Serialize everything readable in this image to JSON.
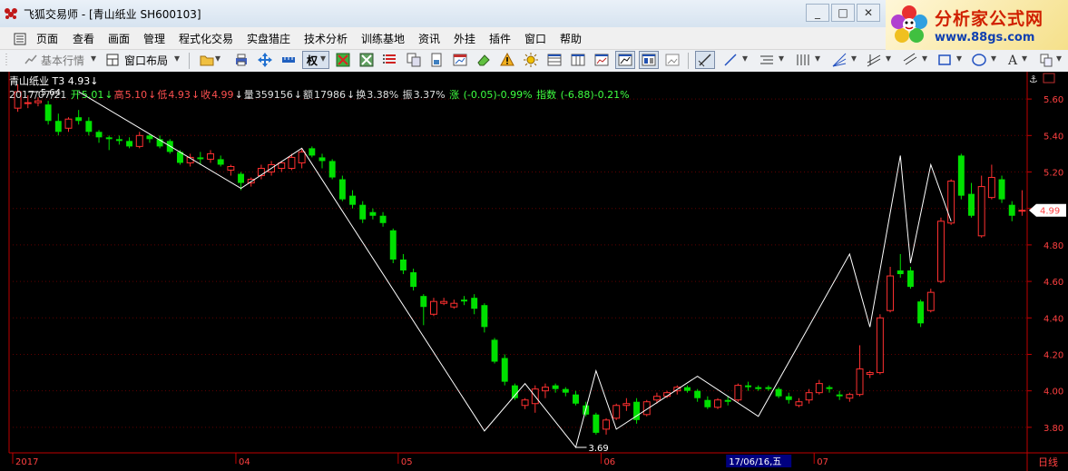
{
  "window": {
    "title": "飞狐交易师 - [青山纸业 SH600103]",
    "btn_min": "_",
    "btn_max": "□",
    "btn_close": "✕"
  },
  "brand": {
    "name": "分析家公式网",
    "url": "www.88gs.com"
  },
  "menu": [
    "页面",
    "查看",
    "画面",
    "管理",
    "程式化交易",
    "实盘猎庄",
    "技术分析",
    "训练基地",
    "资讯",
    "外挂",
    "插件",
    "窗口",
    "帮助"
  ],
  "toolbar": {
    "basic_quote": "基本行情",
    "window_layout": "窗口布局",
    "rights": "权"
  },
  "stock": {
    "name": "青山纸业",
    "cycle_label": "T3",
    "price": "4.93",
    "arrow": "↓",
    "date": "2017/07/21",
    "open_label": "开",
    "open": "5.01",
    "high_label": "高",
    "high": "5.10",
    "low_label": "低",
    "low": "4.93",
    "close_label": "收",
    "close": "4.99",
    "vol_label": "量",
    "vol": "359156",
    "amt_label": "额",
    "amt": "17986",
    "turn_label": "换",
    "turn": "3.38%",
    "amp_label": "振",
    "amp": "3.37%",
    "chg_label": "涨",
    "chg": "(-0.05)-0.99%",
    "idx_label": "指数",
    "idx": "(-6.88)-0.21%"
  },
  "colors": {
    "up": "#ff3030",
    "down": "#00e000",
    "zigzag": "#ffffff",
    "axis": "#c00000"
  },
  "chart_data": {
    "type": "candlestick",
    "y_ticks": [
      "5.60",
      "5.40",
      "5.20",
      "5.00",
      "4.80",
      "4.60",
      "4.40",
      "4.20",
      "4.00",
      "3.80"
    ],
    "ylim": [
      3.66,
      5.72
    ],
    "current_price_tag": "4.99",
    "x_labels": [
      {
        "label": "2017",
        "index": 0
      },
      {
        "label": "04",
        "index": 22
      },
      {
        "label": "05",
        "index": 38
      },
      {
        "label": "06",
        "index": 58
      },
      {
        "label": "07",
        "index": 79
      }
    ],
    "crosshair_date": "17/06/16,五",
    "crosshair_index": 70,
    "cycle": "日线",
    "annotations": [
      {
        "text": "5.64",
        "index": 1,
        "value": 5.64
      },
      {
        "text": "3.69",
        "index": 55,
        "value": 3.69
      }
    ],
    "zigzag": [
      {
        "index": 6,
        "value": 5.64
      },
      {
        "index": 22,
        "value": 5.11
      },
      {
        "index": 28,
        "value": 5.33
      },
      {
        "index": 46,
        "value": 3.78
      },
      {
        "index": 50,
        "value": 4.04
      },
      {
        "index": 55,
        "value": 3.69
      },
      {
        "index": 57,
        "value": 4.11
      },
      {
        "index": 59,
        "value": 3.79
      },
      {
        "index": 67,
        "value": 4.08
      },
      {
        "index": 73,
        "value": 3.86
      },
      {
        "index": 82,
        "value": 4.75
      },
      {
        "index": 84,
        "value": 4.35
      },
      {
        "index": 87,
        "value": 5.29
      },
      {
        "index": 88,
        "value": 4.7
      },
      {
        "index": 90,
        "value": 5.24
      },
      {
        "index": 92,
        "value": 4.93
      }
    ],
    "candles": [
      {
        "o": 5.55,
        "h": 5.68,
        "l": 5.53,
        "c": 5.64
      },
      {
        "o": 5.58,
        "h": 5.62,
        "l": 5.55,
        "c": 5.58
      },
      {
        "o": 5.58,
        "h": 5.61,
        "l": 5.56,
        "c": 5.59
      },
      {
        "o": 5.57,
        "h": 5.59,
        "l": 5.46,
        "c": 5.48
      },
      {
        "o": 5.48,
        "h": 5.52,
        "l": 5.4,
        "c": 5.42
      },
      {
        "o": 5.44,
        "h": 5.5,
        "l": 5.42,
        "c": 5.49
      },
      {
        "o": 5.5,
        "h": 5.54,
        "l": 5.46,
        "c": 5.48
      },
      {
        "o": 5.48,
        "h": 5.5,
        "l": 5.4,
        "c": 5.42
      },
      {
        "o": 5.42,
        "h": 5.43,
        "l": 5.36,
        "c": 5.39
      },
      {
        "o": 5.39,
        "h": 5.4,
        "l": 5.32,
        "c": 5.38
      },
      {
        "o": 5.38,
        "h": 5.4,
        "l": 5.35,
        "c": 5.37
      },
      {
        "o": 5.37,
        "h": 5.39,
        "l": 5.33,
        "c": 5.34
      },
      {
        "o": 5.34,
        "h": 5.42,
        "l": 5.33,
        "c": 5.4
      },
      {
        "o": 5.4,
        "h": 5.41,
        "l": 5.36,
        "c": 5.38
      },
      {
        "o": 5.38,
        "h": 5.4,
        "l": 5.33,
        "c": 5.34
      },
      {
        "o": 5.37,
        "h": 5.38,
        "l": 5.3,
        "c": 5.31
      },
      {
        "o": 5.31,
        "h": 5.32,
        "l": 5.24,
        "c": 5.25
      },
      {
        "o": 5.25,
        "h": 5.3,
        "l": 5.23,
        "c": 5.28
      },
      {
        "o": 5.28,
        "h": 5.31,
        "l": 5.24,
        "c": 5.27
      },
      {
        "o": 5.27,
        "h": 5.32,
        "l": 5.25,
        "c": 5.3
      },
      {
        "o": 5.27,
        "h": 5.29,
        "l": 5.23,
        "c": 5.24
      },
      {
        "o": 5.21,
        "h": 5.24,
        "l": 5.18,
        "c": 5.23
      },
      {
        "o": 5.19,
        "h": 5.2,
        "l": 5.1,
        "c": 5.14
      },
      {
        "o": 5.14,
        "h": 5.17,
        "l": 5.12,
        "c": 5.16
      },
      {
        "o": 5.18,
        "h": 5.24,
        "l": 5.16,
        "c": 5.22
      },
      {
        "o": 5.2,
        "h": 5.26,
        "l": 5.18,
        "c": 5.24
      },
      {
        "o": 5.22,
        "h": 5.26,
        "l": 5.2,
        "c": 5.25
      },
      {
        "o": 5.22,
        "h": 5.3,
        "l": 5.21,
        "c": 5.28
      },
      {
        "o": 5.25,
        "h": 5.33,
        "l": 5.22,
        "c": 5.31
      },
      {
        "o": 5.33,
        "h": 5.34,
        "l": 5.28,
        "c": 5.29
      },
      {
        "o": 5.28,
        "h": 5.3,
        "l": 5.22,
        "c": 5.26
      },
      {
        "o": 5.26,
        "h": 5.27,
        "l": 5.16,
        "c": 5.17
      },
      {
        "o": 5.16,
        "h": 5.18,
        "l": 5.04,
        "c": 5.05
      },
      {
        "o": 5.07,
        "h": 5.1,
        "l": 5.0,
        "c": 5.02
      },
      {
        "o": 5.02,
        "h": 5.04,
        "l": 4.92,
        "c": 4.94
      },
      {
        "o": 4.98,
        "h": 5.0,
        "l": 4.94,
        "c": 4.96
      },
      {
        "o": 4.96,
        "h": 4.98,
        "l": 4.9,
        "c": 4.92
      },
      {
        "o": 4.88,
        "h": 4.89,
        "l": 4.7,
        "c": 4.72
      },
      {
        "o": 4.72,
        "h": 4.75,
        "l": 4.64,
        "c": 4.66
      },
      {
        "o": 4.65,
        "h": 4.67,
        "l": 4.55,
        "c": 4.57
      },
      {
        "o": 4.52,
        "h": 4.53,
        "l": 4.36,
        "c": 4.46
      },
      {
        "o": 4.42,
        "h": 4.51,
        "l": 4.41,
        "c": 4.49
      },
      {
        "o": 4.48,
        "h": 4.51,
        "l": 4.47,
        "c": 4.49
      },
      {
        "o": 4.46,
        "h": 4.5,
        "l": 4.45,
        "c": 4.48
      },
      {
        "o": 4.5,
        "h": 4.52,
        "l": 4.47,
        "c": 4.49
      },
      {
        "o": 4.51,
        "h": 4.53,
        "l": 4.42,
        "c": 4.45
      },
      {
        "o": 4.47,
        "h": 4.48,
        "l": 4.32,
        "c": 4.35
      },
      {
        "o": 4.28,
        "h": 4.29,
        "l": 4.15,
        "c": 4.16
      },
      {
        "o": 4.18,
        "h": 4.2,
        "l": 4.03,
        "c": 4.05
      },
      {
        "o": 4.03,
        "h": 4.04,
        "l": 3.95,
        "c": 3.96
      },
      {
        "o": 3.92,
        "h": 3.96,
        "l": 3.9,
        "c": 3.95
      },
      {
        "o": 3.93,
        "h": 4.03,
        "l": 3.88,
        "c": 4.01
      },
      {
        "o": 4.0,
        "h": 4.04,
        "l": 3.96,
        "c": 4.02
      },
      {
        "o": 4.03,
        "h": 4.04,
        "l": 3.99,
        "c": 4.01
      },
      {
        "o": 4.01,
        "h": 4.02,
        "l": 3.97,
        "c": 3.99
      },
      {
        "o": 3.98,
        "h": 4.0,
        "l": 3.92,
        "c": 3.93
      },
      {
        "o": 3.92,
        "h": 3.94,
        "l": 3.86,
        "c": 3.87
      },
      {
        "o": 3.87,
        "h": 3.88,
        "l": 3.76,
        "c": 3.77
      },
      {
        "o": 3.79,
        "h": 3.85,
        "l": 3.76,
        "c": 3.84
      },
      {
        "o": 3.85,
        "h": 3.93,
        "l": 3.84,
        "c": 3.92
      },
      {
        "o": 3.92,
        "h": 3.96,
        "l": 3.89,
        "c": 3.93
      },
      {
        "o": 3.94,
        "h": 3.96,
        "l": 3.82,
        "c": 3.84
      },
      {
        "o": 3.87,
        "h": 3.95,
        "l": 3.86,
        "c": 3.94
      },
      {
        "o": 3.95,
        "h": 3.99,
        "l": 3.93,
        "c": 3.97
      },
      {
        "o": 3.97,
        "h": 4.0,
        "l": 3.96,
        "c": 3.99
      },
      {
        "o": 4.0,
        "h": 4.03,
        "l": 3.98,
        "c": 4.02
      },
      {
        "o": 4.02,
        "h": 4.03,
        "l": 3.99,
        "c": 4.0
      },
      {
        "o": 4.0,
        "h": 4.01,
        "l": 3.94,
        "c": 3.96
      },
      {
        "o": 3.95,
        "h": 3.97,
        "l": 3.9,
        "c": 3.91
      },
      {
        "o": 3.91,
        "h": 3.96,
        "l": 3.9,
        "c": 3.95
      },
      {
        "o": 3.95,
        "h": 3.97,
        "l": 3.92,
        "c": 3.94
      },
      {
        "o": 3.95,
        "h": 4.04,
        "l": 3.94,
        "c": 4.03
      },
      {
        "o": 4.03,
        "h": 4.05,
        "l": 4.0,
        "c": 4.02
      },
      {
        "o": 4.02,
        "h": 4.03,
        "l": 4.0,
        "c": 4.01
      },
      {
        "o": 4.02,
        "h": 4.03,
        "l": 4.0,
        "c": 4.01
      },
      {
        "o": 4.01,
        "h": 4.02,
        "l": 3.96,
        "c": 3.97
      },
      {
        "o": 3.97,
        "h": 3.99,
        "l": 3.93,
        "c": 3.95
      },
      {
        "o": 3.92,
        "h": 3.96,
        "l": 3.91,
        "c": 3.94
      },
      {
        "o": 3.95,
        "h": 4.01,
        "l": 3.93,
        "c": 3.99
      },
      {
        "o": 3.99,
        "h": 4.06,
        "l": 3.98,
        "c": 4.04
      },
      {
        "o": 4.02,
        "h": 4.03,
        "l": 3.99,
        "c": 4.01
      },
      {
        "o": 3.98,
        "h": 4.0,
        "l": 3.95,
        "c": 3.97
      },
      {
        "o": 3.96,
        "h": 3.99,
        "l": 3.94,
        "c": 3.98
      },
      {
        "o": 3.98,
        "h": 4.25,
        "l": 3.97,
        "c": 4.12
      },
      {
        "o": 4.09,
        "h": 4.11,
        "l": 4.07,
        "c": 4.1
      },
      {
        "o": 4.1,
        "h": 4.42,
        "l": 4.09,
        "c": 4.4
      },
      {
        "o": 4.44,
        "h": 4.68,
        "l": 4.43,
        "c": 4.63
      },
      {
        "o": 4.66,
        "h": 4.75,
        "l": 4.62,
        "c": 4.64
      },
      {
        "o": 4.66,
        "h": 4.68,
        "l": 4.56,
        "c": 4.57
      },
      {
        "o": 4.49,
        "h": 4.5,
        "l": 4.35,
        "c": 4.37
      },
      {
        "o": 4.44,
        "h": 4.56,
        "l": 4.43,
        "c": 4.54
      },
      {
        "o": 4.6,
        "h": 4.95,
        "l": 4.59,
        "c": 4.93
      },
      {
        "o": 4.92,
        "h": 5.16,
        "l": 4.91,
        "c": 5.15
      },
      {
        "o": 5.29,
        "h": 5.3,
        "l": 5.05,
        "c": 5.07
      },
      {
        "o": 5.08,
        "h": 5.14,
        "l": 4.95,
        "c": 4.96
      },
      {
        "o": 4.85,
        "h": 5.18,
        "l": 4.84,
        "c": 5.12
      },
      {
        "o": 5.06,
        "h": 5.24,
        "l": 5.05,
        "c": 5.17
      },
      {
        "o": 5.16,
        "h": 5.18,
        "l": 5.03,
        "c": 5.05
      },
      {
        "o": 5.02,
        "h": 5.04,
        "l": 4.93,
        "c": 4.96
      },
      {
        "o": 4.99,
        "h": 5.1,
        "l": 4.96,
        "c": 4.99
      }
    ]
  }
}
